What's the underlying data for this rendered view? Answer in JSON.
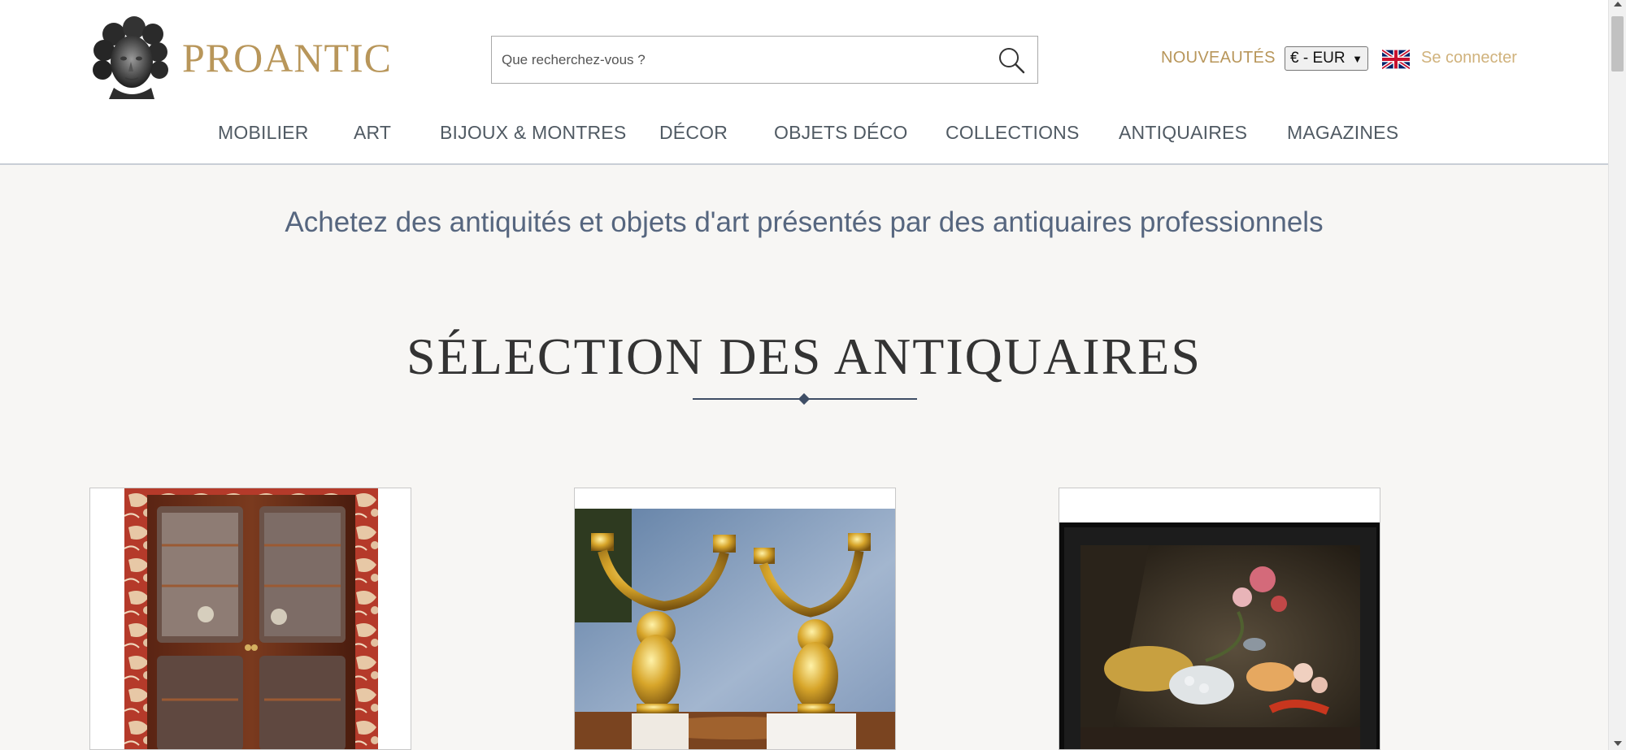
{
  "brand": {
    "name": "PROANTIC",
    "logo_icon": "bust-icon",
    "color": "#b8965a"
  },
  "search": {
    "placeholder": "Que recherchez-vous ?",
    "icon": "search-icon"
  },
  "header_links": {
    "nouveautes": "NOUVEAUTÉS",
    "currency": "€ - EUR",
    "language_flag": "uk-flag-icon",
    "login": "Se connecter"
  },
  "nav": {
    "items": [
      "MOBILIER",
      "ART",
      "BIJOUX & MONTRES",
      "DÉCOR",
      "OBJETS DÉCO",
      "COLLECTIONS",
      "ANTIQUAIRES",
      "MAGAZINES"
    ]
  },
  "tagline": "Achetez des antiquités et objets d'art présentés par des antiquaires professionnels",
  "section": {
    "title": "SÉLECTION DES ANTIQUAIRES"
  },
  "colors": {
    "accent": "#b8965a",
    "nav_text": "#505a63",
    "tagline": "#56667f",
    "background": "#f7f6f4",
    "rule": "#3f4e66"
  }
}
